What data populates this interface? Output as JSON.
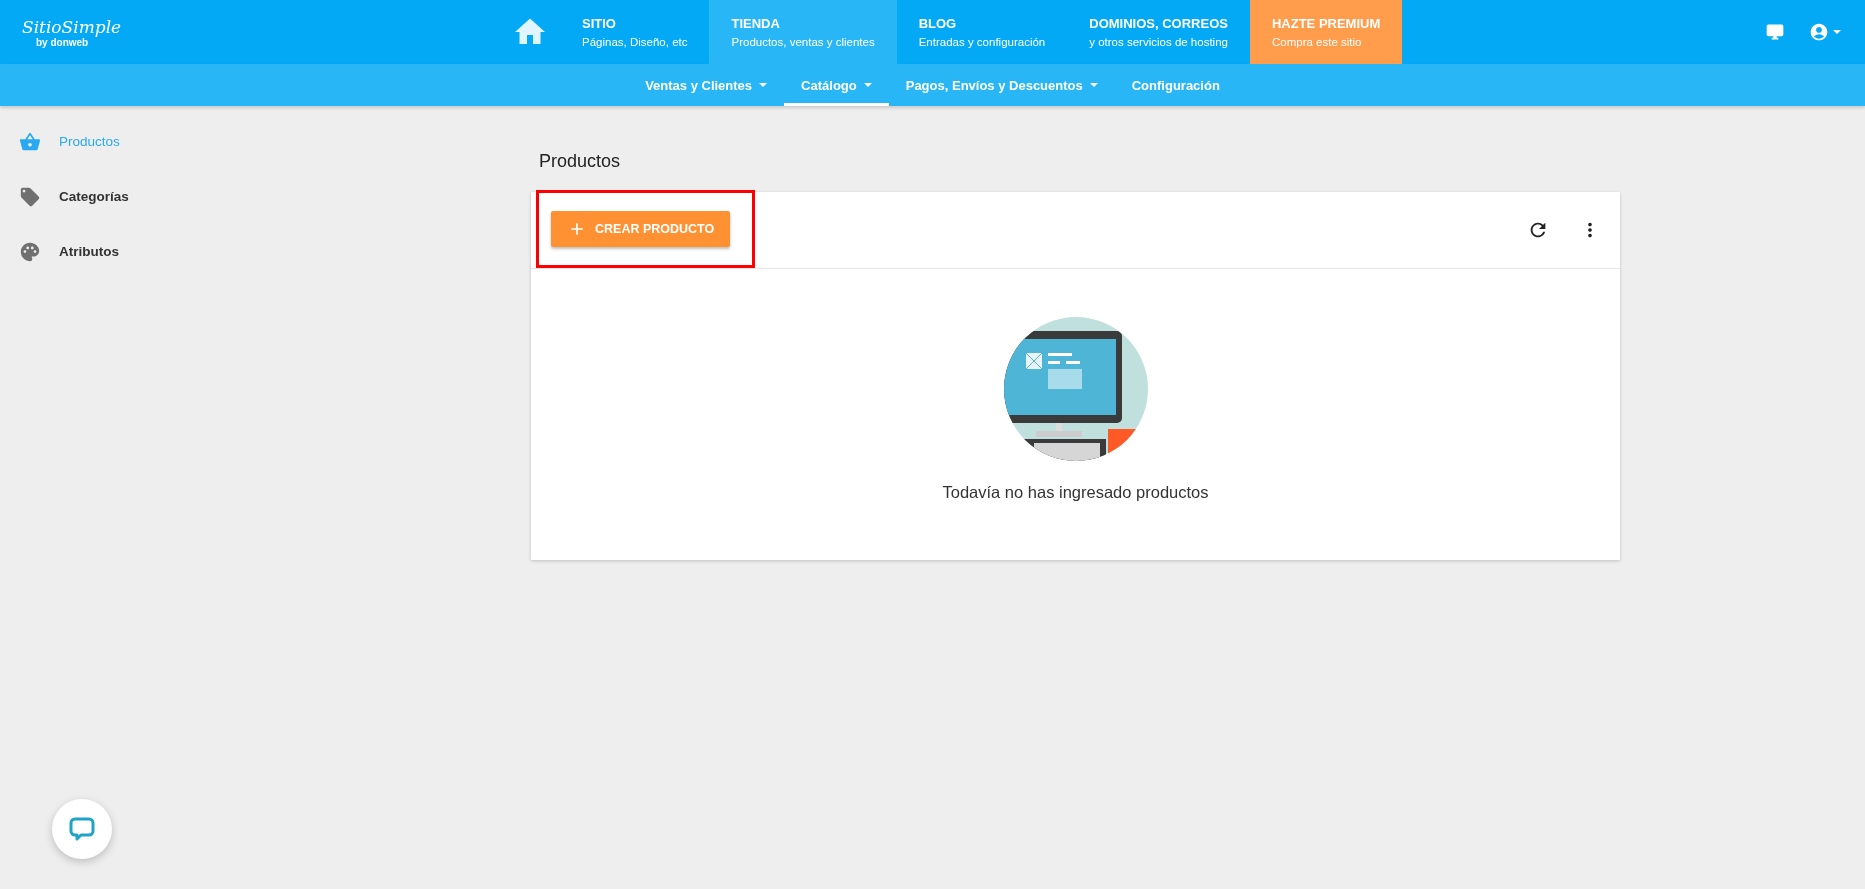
{
  "logo": {
    "name": "SitioSimple",
    "byline": "by donweb"
  },
  "nav": [
    {
      "title": "SITIO",
      "subtitle": "Páginas, Diseño, etc",
      "selected": false,
      "kind": "normal"
    },
    {
      "title": "TIENDA",
      "subtitle": "Productos, ventas y clientes",
      "selected": true,
      "kind": "normal"
    },
    {
      "title": "BLOG",
      "subtitle": "Entradas y configuración",
      "selected": false,
      "kind": "normal"
    },
    {
      "title": "DOMINIOS, CORREOS",
      "subtitle": "y otros servicios de hosting",
      "selected": false,
      "kind": "normal"
    },
    {
      "title": "HAZTE PREMIUM",
      "subtitle": "Compra este sitio",
      "selected": false,
      "kind": "premium"
    }
  ],
  "subnav": [
    {
      "label": "Ventas y Clientes",
      "dropdown": true,
      "selected": false
    },
    {
      "label": "Catálogo",
      "dropdown": true,
      "selected": true
    },
    {
      "label": "Pagos, Envíos y Descuentos",
      "dropdown": true,
      "selected": false
    },
    {
      "label": "Configuración",
      "dropdown": false,
      "selected": false
    }
  ],
  "sidebar": {
    "items": [
      {
        "label": "Productos",
        "kind": "basket",
        "selected": true
      },
      {
        "label": "Categorías",
        "kind": "tags",
        "selected": false
      },
      {
        "label": "Atributos",
        "kind": "palette",
        "selected": false
      }
    ]
  },
  "page": {
    "title": "Productos",
    "create_button": {
      "label": "CREAR PRODUCTO",
      "highlighted": true
    },
    "empty_message": "Todavía no has ingresado productos"
  }
}
